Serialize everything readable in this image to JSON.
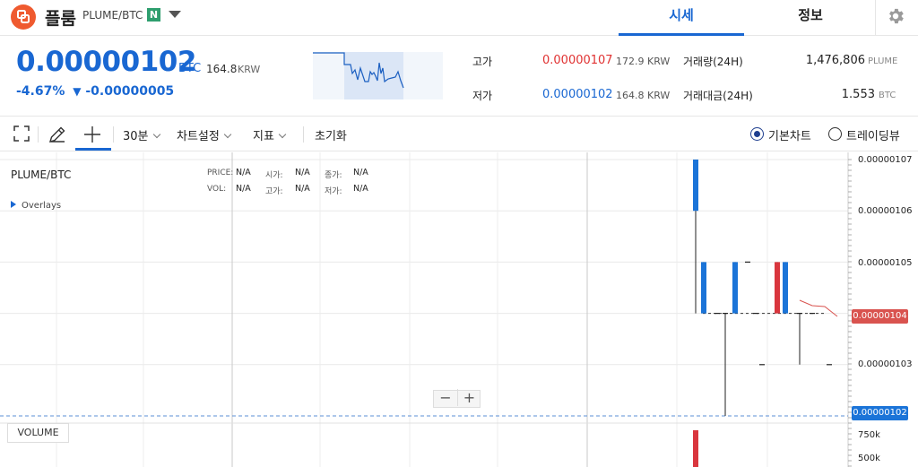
{
  "header": {
    "coin_name": "플룸",
    "pair": "PLUME/BTC",
    "badge": "N",
    "tabs": [
      "시세",
      "정보"
    ],
    "icons": [
      "plume-logo-icon",
      "chevron-down-icon",
      "gear-icon"
    ]
  },
  "price_panel": {
    "price": "0.00000102",
    "price_unit": "BTC",
    "price_krw": "164.8",
    "price_krw_unit": "KRW",
    "change_pct": "-4.67%",
    "change_arrow": "▼",
    "change_abs": "-0.00000005",
    "high_label": "고가",
    "high_value": "0.00000107",
    "high_krw": "172.9 KRW",
    "low_label": "저가",
    "low_value": "0.00000102",
    "low_krw": "164.8 KRW",
    "volume_label": "거래량(24H)",
    "volume_value": "1,476,806",
    "volume_unit": "PLUME",
    "trade_value_label": "거래대금(24H)",
    "trade_value_value": "1.553",
    "trade_value_unit": "BTC"
  },
  "toolbar": {
    "interval": "30분",
    "chart_settings": "차트설정",
    "indicators": "지표",
    "reset": "초기화",
    "basic_chart": "기본차트",
    "tradingview": "트레이딩뷰",
    "selected_chart": "기본차트"
  },
  "chart": {
    "symbol": "PLUME/BTC",
    "legend": {
      "price_label": "PRICE:",
      "price_value": "N/A",
      "open_label": "시가:",
      "open_value": "N/A",
      "close_label": "종가:",
      "close_value": "N/A",
      "vol_label": "VOL:",
      "vol_value": "N/A",
      "high_label": "고가:",
      "high_value": "N/A",
      "low_label": "저가:",
      "low_value": "N/A"
    },
    "overlays_label": "Overlays",
    "zoom_out": "−",
    "zoom_in": "+",
    "volume_button": "VOLUME",
    "y_ticks": [
      "0.00000107",
      "0.00000106",
      "0.00000105",
      "0.00000103"
    ],
    "volume_ticks": [
      "750k",
      "500k"
    ],
    "last_price_tag": "0.00000104",
    "current_price_tag": "0.00000102",
    "colors": {
      "up": "#d9363e",
      "down": "#1b74d8",
      "accent": "#1967d2"
    }
  },
  "chart_data": {
    "type": "candlestick",
    "ylim": [
      1.02e-06,
      1.07e-06
    ],
    "candles": [
      {
        "open": 1.07e-06,
        "close": 1.06e-06,
        "high": 1.07e-06,
        "low": 1.04e-06
      },
      {
        "open": 1.05e-06,
        "close": 1.04e-06,
        "high": 1.05e-06,
        "low": 1.04e-06
      },
      {
        "open": 1.04e-06,
        "close": 1.04e-06,
        "high": 1.04e-06,
        "low": 1.04e-06
      },
      {
        "open": 1.04e-06,
        "close": 1.04e-06,
        "high": 1.04e-06,
        "low": 1.02e-06
      },
      {
        "open": 1.05e-06,
        "close": 1.04e-06,
        "high": 1.05e-06,
        "low": 1.04e-06
      },
      {
        "open": 1.05e-06,
        "close": 1.05e-06,
        "high": 1.05e-06,
        "low": 1.05e-06
      },
      {
        "open": 1.04e-06,
        "close": 1.04e-06,
        "high": 1.04e-06,
        "low": 1.04e-06
      },
      {
        "open": 1.03e-06,
        "close": 1.03e-06,
        "high": 1.03e-06,
        "low": 1.03e-06
      },
      {
        "open": 1.04e-06,
        "close": 1.05e-06,
        "high": 1.05e-06,
        "low": 1.04e-06
      },
      {
        "open": 1.05e-06,
        "close": 1.04e-06,
        "high": 1.05e-06,
        "low": 1.04e-06
      },
      {
        "open": 1.04e-06,
        "close": 1.04e-06,
        "high": 1.04e-06,
        "low": 1.03e-06
      },
      {
        "open": 1.04e-06,
        "close": 1.04e-06,
        "high": 1.04e-06,
        "low": 1.04e-06
      },
      {
        "open": 1.03e-06,
        "close": 1.03e-06,
        "high": 1.03e-06,
        "low": 1.03e-06
      }
    ]
  }
}
